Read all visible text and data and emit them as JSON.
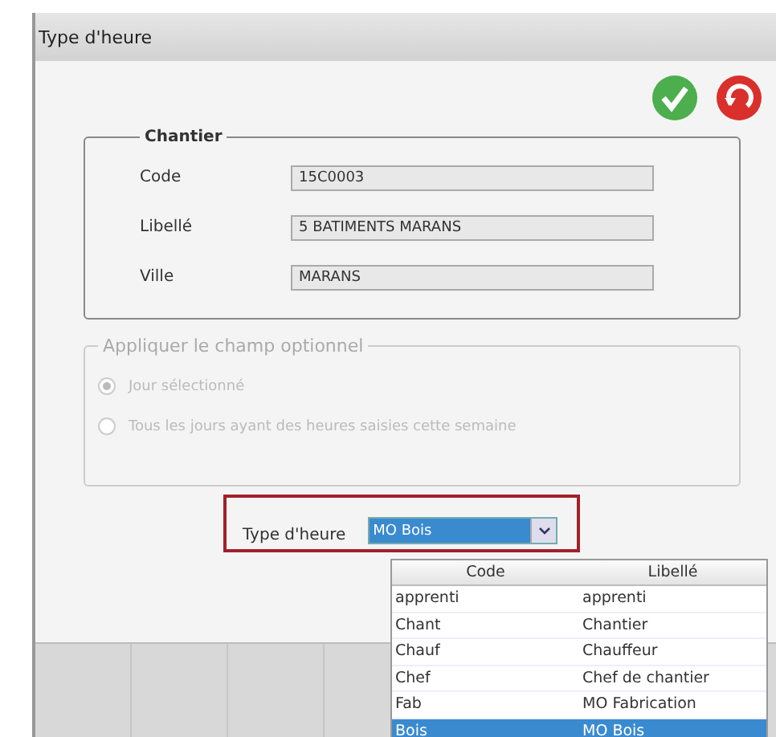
{
  "window": {
    "title": "Type d'heure"
  },
  "toolbar": [
    {
      "kind": "ok"
    },
    {
      "kind": "cancel"
    }
  ],
  "chantier": {
    "legend": "Chantier",
    "fields": [
      {
        "label": "Code",
        "value": "15C0003"
      },
      {
        "label": "Libellé",
        "value": "5 BATIMENTS MARANS"
      },
      {
        "label": "Ville",
        "value": "MARANS"
      }
    ]
  },
  "optional": {
    "legend": "Appliquer le champ optionnel",
    "disabled": true,
    "options": [
      {
        "label": "Jour sélectionné",
        "selected": true
      },
      {
        "label": "Tous les jours ayant des heures saisies cette semaine",
        "selected": false
      }
    ]
  },
  "type_heure": {
    "label": "Type d'heure",
    "value": "MO Bois",
    "highlighted": true
  },
  "dropdown": {
    "columns": [
      "Code",
      "Libellé"
    ],
    "rows": [
      {
        "cells": [
          "apprenti",
          "apprenti"
        ],
        "selected": false
      },
      {
        "cells": [
          "Chant",
          "Chantier"
        ],
        "selected": false
      },
      {
        "cells": [
          "Chauf",
          "Chauffeur"
        ],
        "selected": false
      },
      {
        "cells": [
          "Chef",
          "Chef de chantier"
        ],
        "selected": false
      },
      {
        "cells": [
          "Fab",
          "MO Fabrication"
        ],
        "selected": false
      },
      {
        "cells": [
          "Bois",
          "MO Bois"
        ],
        "selected": true
      }
    ]
  }
}
